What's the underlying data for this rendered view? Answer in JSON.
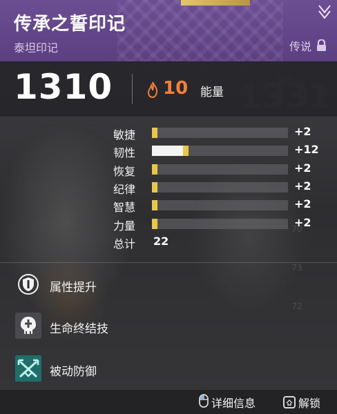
{
  "header": {
    "title": "传承之誓印记",
    "subtitle": "泰坦印记",
    "rarity": "传说",
    "icons": {
      "lock": "lock-icon",
      "corner": "class-emblem-icon"
    },
    "colors": {
      "banner": "#5b3f80",
      "exotic_strip": "#e3c66a"
    }
  },
  "power": {
    "value": "1310",
    "energy_value": "10",
    "energy_label": "能量",
    "energy_icon": "flame-icon",
    "energy_color": "#f3803a"
  },
  "background_ghost": {
    "label": "能量",
    "value": "1331",
    "stat_values": [
      "70",
      "73",
      "72"
    ]
  },
  "stats": {
    "items": [
      {
        "label": "敏捷",
        "value": "+2",
        "base_fraction": 0.0,
        "mod_fraction": 0.04
      },
      {
        "label": "韧性",
        "value": "+12",
        "base_fraction": 0.23,
        "mod_fraction": 0.04
      },
      {
        "label": "恢复",
        "value": "+2",
        "base_fraction": 0.0,
        "mod_fraction": 0.04
      },
      {
        "label": "纪律",
        "value": "+2",
        "base_fraction": 0.0,
        "mod_fraction": 0.04
      },
      {
        "label": "智慧",
        "value": "+2",
        "base_fraction": 0.0,
        "mod_fraction": 0.04
      },
      {
        "label": "力量",
        "value": "+2",
        "base_fraction": 0.0,
        "mod_fraction": 0.04
      }
    ],
    "total_label": "总计",
    "total_value": "22",
    "colors": {
      "base": "#f3f3f3",
      "mod": "#e7c64a"
    }
  },
  "perks": [
    {
      "label": "属性提升",
      "icon": "shield-upgrade-icon"
    },
    {
      "label": "生命终结技",
      "icon": "finisher-skull-icon"
    },
    {
      "label": "被动防御",
      "icon": "crossed-arrows-icon"
    }
  ],
  "footer": {
    "details_label": "详细信息",
    "details_icon": "mouse-icon",
    "unlock_label": "解锁",
    "unlock_icon": "key-icon"
  }
}
